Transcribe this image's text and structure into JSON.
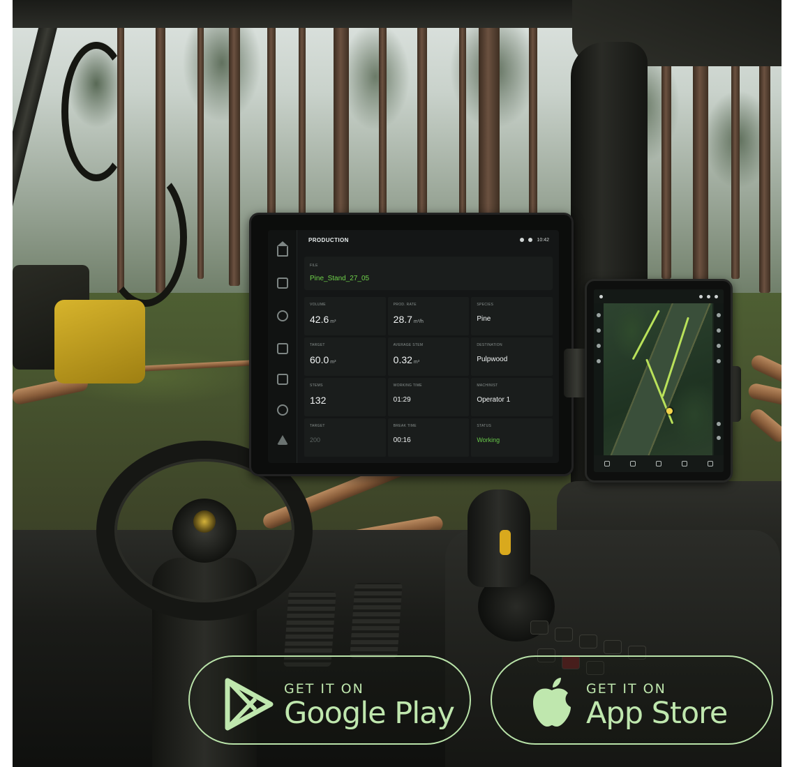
{
  "main_display": {
    "title": "PRODUCTION",
    "time": "10:42",
    "file": {
      "label": "FILE",
      "name": "Pine_Stand_27_05"
    },
    "metrics": [
      {
        "label": "VOLUME",
        "value": "42.6",
        "unit": "m³",
        "style": "big"
      },
      {
        "label": "PROD. RATE",
        "value": "28.7",
        "unit": "m³/h",
        "style": "big"
      },
      {
        "label": "SPECIES",
        "value": "Pine",
        "unit": "",
        "style": "small"
      },
      {
        "label": "TARGET",
        "value": "60.0",
        "unit": "m³",
        "style": "big"
      },
      {
        "label": "AVERAGE STEM",
        "value": "0.32",
        "unit": "m³",
        "style": "big"
      },
      {
        "label": "DESTINATION",
        "value": "Pulpwood",
        "unit": "",
        "style": "small"
      },
      {
        "label": "STEMS",
        "value": "132",
        "unit": "",
        "style": "big"
      },
      {
        "label": "WORKING TIME",
        "value": "01:29",
        "unit": "",
        "style": "small"
      },
      {
        "label": "MACHINIST",
        "value": "Operator 1",
        "unit": "",
        "style": "small"
      },
      {
        "label": "TARGET",
        "value": "200",
        "unit": "",
        "style": "dim"
      },
      {
        "label": "BREAK TIME",
        "value": "00:16",
        "unit": "",
        "style": "small"
      },
      {
        "label": "STATUS",
        "value": "Working",
        "unit": "",
        "style": "green"
      }
    ],
    "nav_icons": [
      "home-icon",
      "clipboard-icon",
      "gauge-icon",
      "map-icon",
      "chart-icon",
      "settings-icon",
      "warning-icon"
    ]
  },
  "store_badges": {
    "google_play": {
      "small": "GET IT ON",
      "big": "Google Play"
    },
    "app_store": {
      "small": "GET IT ON",
      "big": "App Store"
    }
  },
  "colors": {
    "accent_green": "#6fd24a",
    "badge_green": "#bfe7ae",
    "screen_bg": "#141616"
  }
}
